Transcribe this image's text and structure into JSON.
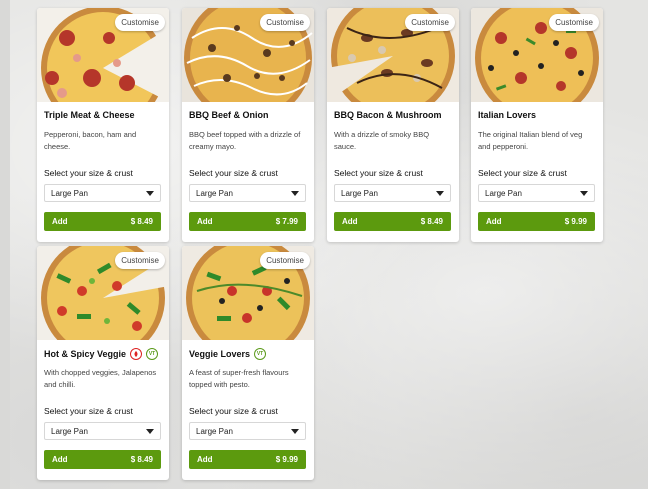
{
  "customise_label": "Customise",
  "select_label": "Select your size & crust",
  "add_label": "Add",
  "colors": {
    "add_button": "#5c9a0e",
    "veg_badge": "#5a9a1a",
    "hot_badge": "#dd2222"
  },
  "pizzas": [
    {
      "name": "Triple Meat & Cheese",
      "description": "Pepperoni, bacon, ham and cheese.",
      "size": "Large Pan",
      "price": "$ 8.49"
    },
    {
      "name": "BBQ Beef & Onion",
      "description": "BBQ beef topped with a drizzle of creamy mayo.",
      "size": "Large Pan",
      "price": "$ 7.99"
    },
    {
      "name": "BBQ Bacon & Mushroom",
      "description": "With a drizzle of smoky BBQ sauce.",
      "size": "Large Pan",
      "price": "$ 8.49"
    },
    {
      "name": "Italian Lovers",
      "description": "The original Italian blend of veg and pepperoni.",
      "size": "Large Pan",
      "price": "$ 9.99"
    },
    {
      "name": "Hot & Spicy Veggie",
      "description": "With chopped veggies, Jalapenos and chilli.",
      "size": "Large Pan",
      "price": "$ 8.49",
      "badges": [
        "hot-icon",
        "vegetarian-icon"
      ],
      "vt": "VT"
    },
    {
      "name": "Veggie Lovers",
      "description": "A feast of super-fresh flavours topped with pesto.",
      "size": "Large Pan",
      "price": "$ 9.99",
      "badges": [
        "vegetarian-icon"
      ],
      "vt": "VT"
    }
  ]
}
